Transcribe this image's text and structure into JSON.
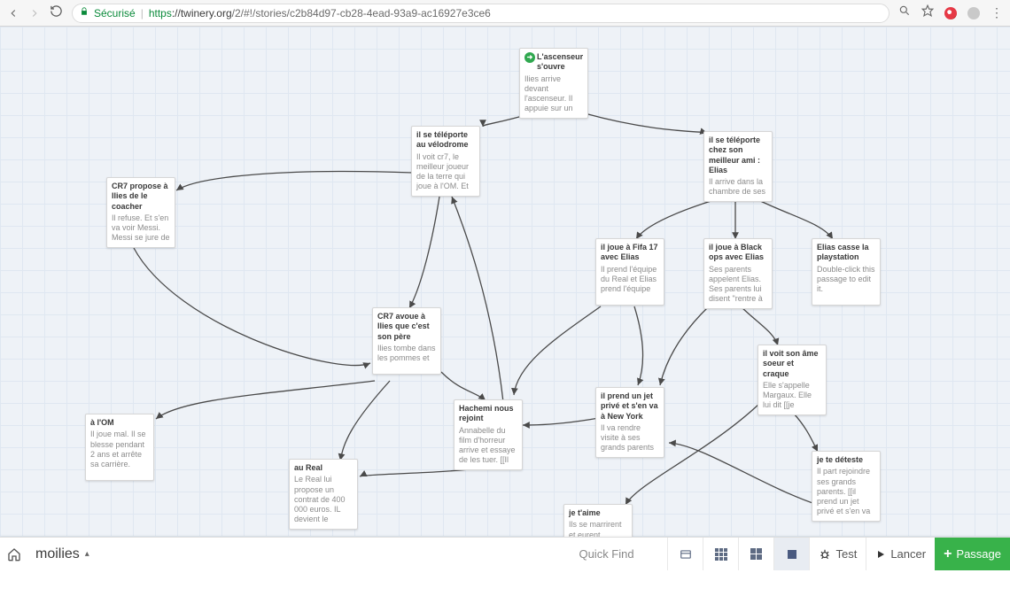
{
  "browser": {
    "secure_label": "Sécurisé",
    "url_proto": "https",
    "url_host": "://twinery.org",
    "url_rest": "/2/#!/stories/c2b84d97-cb28-4ead-93a9-ac16927e3ce6"
  },
  "story": {
    "name": "moilies"
  },
  "toolbar": {
    "quickfind_placeholder": "Quick Find",
    "test_label": "Test",
    "play_label": "Lancer",
    "add_label": "Passage"
  },
  "passages": {
    "start": {
      "title": "L'ascenseur s'ouvre",
      "body": "Ilies arrive devant l'ascenseur. Il appuie sur un"
    },
    "velo": {
      "title": "il se téléporte au vélodrome",
      "body": "Il voit cr7, le meilleur joueur de la terre qui joue à l'OM. Et"
    },
    "coacher": {
      "title": "CR7 propose à Ilies de le coacher",
      "body": "Il refuse. Et s'en va voir Messi. Messi se jure de"
    },
    "avoue": {
      "title": "CR7 avoue à Ilies que c'est son père",
      "body": "Ilies tombe dans les pommes et"
    },
    "om": {
      "title": "à l'OM",
      "body": "Il joue mal. Il se blesse pendant 2 ans et arrête sa carrière."
    },
    "real": {
      "title": "au Real",
      "body": "Le Real lui propose un contrat de 400 000 euros. IL devient le"
    },
    "hachemi": {
      "title": "Hachemi nous rejoint",
      "body": "Annabelle du film d'horreur arrive et essaye de les tuer. [[Il"
    },
    "ami": {
      "title": "il se téléporte chez son meilleur ami : Elias",
      "body": "Il arrive dans la chambre de ses"
    },
    "fifa": {
      "title": "il joue à Fifa 17 avec Elias",
      "body": "Il prend l'équipe du Real et Elias prend l'équipe"
    },
    "blackops": {
      "title": "il joue à Black ops avec Elias",
      "body": "Ses parents appelent Elias. Ses parents lui disent \"rentre à"
    },
    "casse": {
      "title": "Elias casse la playstation",
      "body": "Double-click this passage to edit it."
    },
    "ame": {
      "title": "il voit son âme soeur et craque",
      "body": "Elle s'appelle Margaux. Elle lui dit [[je"
    },
    "jet": {
      "title": "il prend un jet privé et s'en va à New York",
      "body": "Il va rendre visite à ses grands parents"
    },
    "taime": {
      "title": "je t'aime",
      "body": "Ils se marrirent et eurent beaucoup d'enfants."
    },
    "deteste": {
      "title": "je te déteste",
      "body": "Il part rejoindre ses grands parents. [[il prend un jet privé et s'en va"
    }
  }
}
